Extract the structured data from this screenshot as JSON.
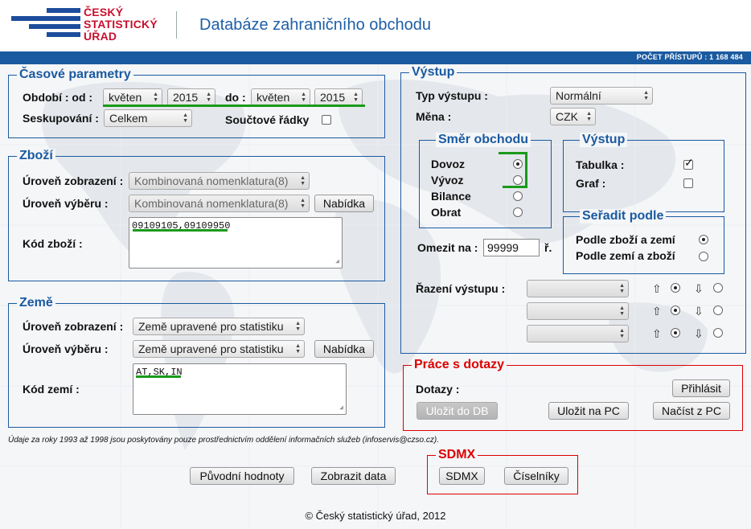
{
  "header": {
    "logo_lines": [
      "ČESKÝ",
      "STATISTICKÝ",
      "ÚŘAD"
    ],
    "title": "Databáze zahraničního obchodu",
    "access_count": "POČET PŘÍSTUPŮ : 1 168 484"
  },
  "time": {
    "legend": "Časové parametry",
    "period_label": "Období : od :",
    "from_month": "květen",
    "from_year": "2015",
    "to_label": "do :",
    "to_month": "květen",
    "to_year": "2015",
    "grouping_label": "Seskupování :",
    "grouping_value": "Celkem",
    "sum_rows_label": "Součtové řádky"
  },
  "goods": {
    "legend": "Zboží",
    "display_level_label": "Úroveň zobrazení :",
    "display_level_value": "Kombinovaná nomenklatura(8)",
    "select_level_label": "Úroveň výběru :",
    "select_level_value": "Kombinovaná nomenklatura(8)",
    "offer_button": "Nabídka",
    "code_label": "Kód zboží :",
    "code_value": "09109105,09109950"
  },
  "country": {
    "legend": "Země",
    "display_level_label": "Úroveň zobrazení :",
    "display_level_value": "Země upravené pro statistiku",
    "select_level_label": "Úroveň výběru :",
    "select_level_value": "Země upravené pro statistiku",
    "offer_button": "Nabídka",
    "code_label": "Kód zemí :",
    "code_value": "AT,SK,IN"
  },
  "note": "Údaje za roky 1993 až 1998 jsou poskytovány pouze prostřednictvím oddělení informačních služeb (infoservis@czso.cz).",
  "buttons": {
    "original_values": "Původní hodnoty",
    "show_data": "Zobrazit data"
  },
  "output": {
    "legend": "Výstup",
    "type_label": "Typ výstupu :",
    "type_value": "Normální",
    "currency_label": "Měna :",
    "currency_value": "CZK",
    "direction": {
      "legend": "Směr obchodu",
      "options": [
        "Dovoz",
        "Vývoz",
        "Bilance",
        "Obrat"
      ],
      "selected": "Dovoz"
    },
    "output_box": {
      "legend": "Výstup",
      "table_label": "Tabulka :",
      "table_checked": true,
      "graph_label": "Graf :",
      "graph_checked": false
    },
    "sort": {
      "legend": "Seřadit podle",
      "options": [
        "Podle zboží a zemí",
        "Podle zemí a zboží"
      ],
      "selected": "Podle zboží a zemí"
    },
    "limit_label": "Omezit na :",
    "limit_value": "99999",
    "limit_unit": "ř.",
    "ordering_label": "Řazení výstupu :"
  },
  "queries": {
    "legend": "Práce s dotazy",
    "label": "Dotazy :",
    "login": "Přihlásit",
    "save_db": "Uložit do DB",
    "save_pc": "Uložit na PC",
    "load_pc": "Načíst z PC"
  },
  "sdmx": {
    "legend": "SDMX",
    "sdmx_button": "SDMX",
    "codelists_button": "Číselníky"
  },
  "footer": "© Český statistický úřad, 2012",
  "colors": {
    "brand_blue": "#1a5aa0",
    "logo_red": "#c8102e",
    "frame_red": "#dd0000",
    "highlight_green": "#1a9a1a"
  }
}
